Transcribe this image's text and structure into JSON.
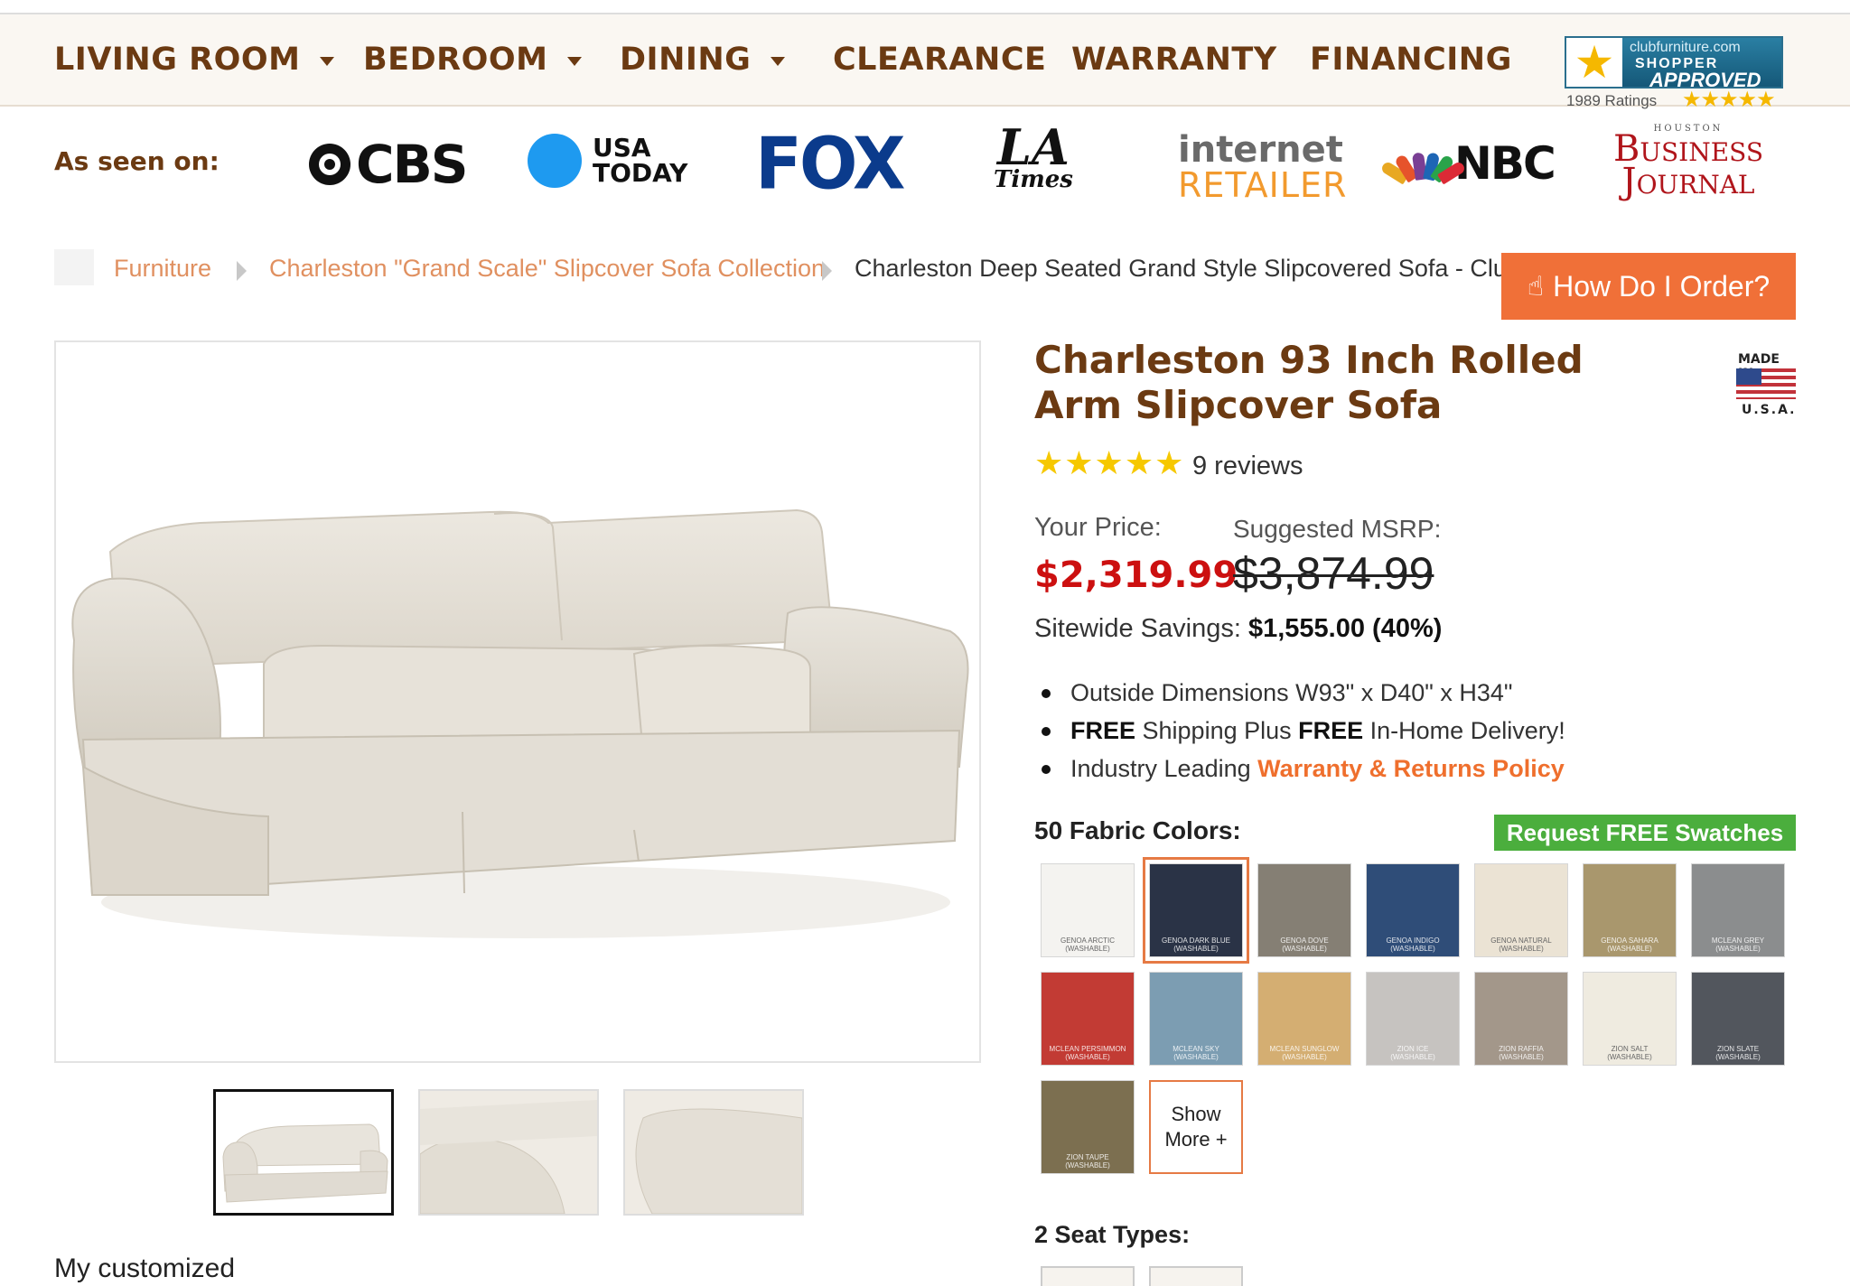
{
  "nav": {
    "items": [
      {
        "label": "LIVING ROOM",
        "dropdown": true
      },
      {
        "label": "BEDROOM",
        "dropdown": true
      },
      {
        "label": "DINING",
        "dropdown": true
      },
      {
        "label": "CLEARANCE",
        "dropdown": false
      },
      {
        "label": "WARRANTY",
        "dropdown": false
      },
      {
        "label": "FINANCING",
        "dropdown": false
      }
    ],
    "shopper_approved": {
      "site": "clubfurniture.com",
      "line1": "SHOPPER",
      "line2": "APPROVED",
      "ratings": "1989 Ratings",
      "stars": "★★★★★"
    }
  },
  "as_seen_on": {
    "label": "As seen on:",
    "logos": {
      "cbs": "CBS",
      "usa_today_1": "USA",
      "usa_today_2": "TODAY",
      "fox": "FOX",
      "la_times_1": "LA",
      "la_times_2": "Times",
      "internet_retailer_1": "internet",
      "internet_retailer_2": "RETAILER",
      "nbc": "NBC",
      "business_journal_top": "HOUSTON",
      "business_journal_1": "Business",
      "business_journal_2": "Journal"
    }
  },
  "breadcrumb": {
    "items": [
      "Furniture",
      "Charleston \"Grand Scale\" Slipcover Sofa Collection",
      "Charleston Deep Seated Grand Style Slipcovered Sofa - Club F"
    ]
  },
  "how_to_order": {
    "label": "How Do I Order?",
    "icon": "hand-pointer-icon"
  },
  "product": {
    "title": "Charleston 93 Inch Rolled Arm Slipcover Sofa",
    "made_in_line1": "MADE IN",
    "made_in_line2": "U.S.A.",
    "rating_stars": "★★★★★",
    "rating": 5,
    "reviews": "9 reviews",
    "your_price_label": "Your Price:",
    "price": "$2,319.99",
    "msrp_label": "Suggested MSRP:",
    "msrp": "$3,874.99",
    "savings_label": "Sitewide Savings:",
    "savings_value": "$1,555.00 (40%)",
    "bullets": {
      "dimensions": "Outside Dimensions W93\" x D40\" x H34\"",
      "free1": "FREE",
      "shipping": " Shipping Plus ",
      "free2": "FREE",
      "delivery": " In-Home Delivery!",
      "industry": "Industry Leading ",
      "warranty_link": "Warranty & Returns Policy"
    },
    "fabric_label": "50 Fabric Colors:",
    "swatch_button": "Request FREE Swatches",
    "swatches": [
      {
        "name": "GENOA ARCTIC",
        "sub": "(WASHABLE)",
        "color": "#f4f3f0"
      },
      {
        "name": "GENOA DARK BLUE",
        "sub": "(WASHABLE)",
        "color": "#2a3346"
      },
      {
        "name": "GENOA DOVE",
        "sub": "(WASHABLE)",
        "color": "#857f74"
      },
      {
        "name": "GENOA INDIGO",
        "sub": "(WASHABLE)",
        "color": "#2f4d78"
      },
      {
        "name": "GENOA NATURAL",
        "sub": "(WASHABLE)",
        "color": "#ebe3d4"
      },
      {
        "name": "GENOA SAHARA",
        "sub": "(WASHABLE)",
        "color": "#a9976d"
      },
      {
        "name": "MCLEAN GREY",
        "sub": "(WASHABLE)",
        "color": "#8b8d8e"
      },
      {
        "name": "MCLEAN PERSIMMON",
        "sub": "(WASHABLE)",
        "color": "#c23b34"
      },
      {
        "name": "MCLEAN SKY",
        "sub": "(WASHABLE)",
        "color": "#7c9db2"
      },
      {
        "name": "MCLEAN SUNGLOW",
        "sub": "(WASHABLE)",
        "color": "#d4ae72"
      },
      {
        "name": "ZION ICE",
        "sub": "(WASHABLE)",
        "color": "#c6c3c0"
      },
      {
        "name": "ZION RAFFIA",
        "sub": "(WASHABLE)",
        "color": "#a3978a"
      },
      {
        "name": "ZION SALT",
        "sub": "(WASHABLE)",
        "color": "#efebe0"
      },
      {
        "name": "ZION SLATE",
        "sub": "(WASHABLE)",
        "color": "#52565d"
      },
      {
        "name": "ZION TAUPE",
        "sub": "(WASHABLE)",
        "color": "#7c6f50"
      }
    ],
    "selected_swatch": "GENOA DARK BLUE",
    "show_more": "Show More +",
    "seat_label": "2 Seat Types:",
    "customized": "My customized"
  }
}
